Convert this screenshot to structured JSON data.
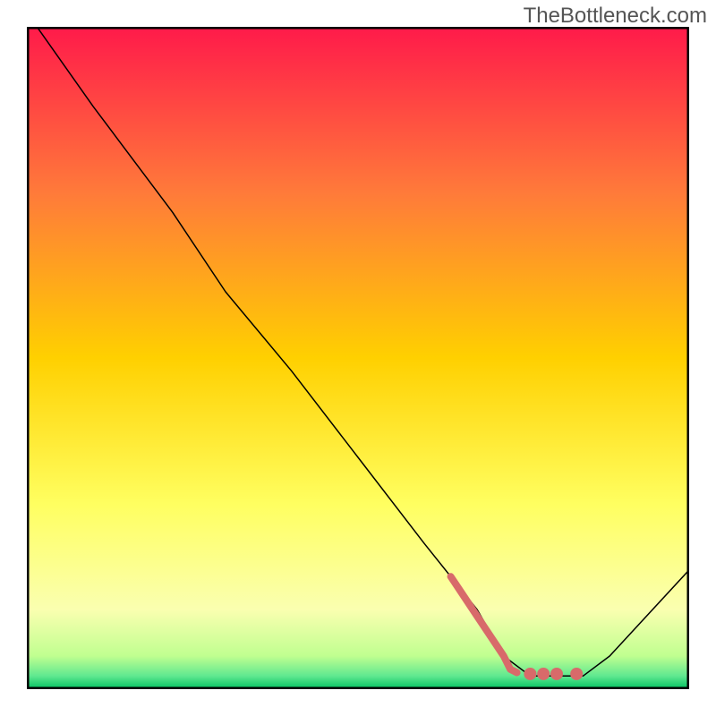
{
  "watermark": "TheBottleneck.com",
  "chart_data": {
    "type": "line",
    "title": "",
    "xlabel": "",
    "ylabel": "",
    "xlim": [
      0,
      100
    ],
    "ylim": [
      0,
      100
    ],
    "background_gradient": {
      "top": "#ff1a4a",
      "upper_mid": "#ff9a3a",
      "mid": "#ffe000",
      "lower_mid": "#ffff80",
      "near_bottom": "#d0ff80",
      "bottom": "#00d060"
    },
    "series": [
      {
        "name": "curve",
        "type": "line",
        "color": "#000000",
        "width": 1.5,
        "x": [
          -2,
          10,
          22,
          30,
          40,
          50,
          60,
          68,
          72,
          76,
          80,
          84,
          88,
          100
        ],
        "y": [
          105,
          88,
          72,
          60,
          48,
          35,
          22,
          12,
          5,
          2,
          2,
          2,
          5,
          18
        ]
      },
      {
        "name": "highlight-segment",
        "type": "line",
        "color": "#d86a6a",
        "width": 8,
        "linecap": "round",
        "x": [
          64,
          66,
          68,
          70,
          72,
          73,
          74
        ],
        "y": [
          17,
          14,
          11,
          8,
          5,
          3,
          2.5
        ]
      },
      {
        "name": "highlight-dots",
        "type": "scatter",
        "color": "#d86a6a",
        "size": 7,
        "x": [
          76,
          78,
          80,
          83
        ],
        "y": [
          2.3,
          2.3,
          2.3,
          2.3
        ]
      }
    ]
  }
}
